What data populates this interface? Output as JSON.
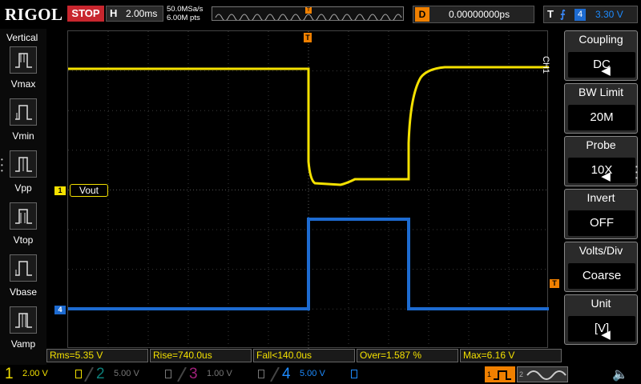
{
  "brand": "RIGOL",
  "run_status": "STOP",
  "horizontal": {
    "label": "H",
    "scale": "2.00ms"
  },
  "acquisition": {
    "sample_rate": "50.0MSa/s",
    "memory_depth": "6.00M pts"
  },
  "delay": {
    "label": "D",
    "value": "0.00000000ps"
  },
  "trigger": {
    "label": "T",
    "edge": "rising",
    "source": "4",
    "level": "3.30 V",
    "marker": "T"
  },
  "left_panel": {
    "title": "Vertical",
    "items": [
      "Vmax",
      "Vmin",
      "Vpp",
      "Vtop",
      "Vbase",
      "Vamp"
    ]
  },
  "channel_tab": "CH1",
  "menu": [
    {
      "title": "Coupling",
      "value": "DC"
    },
    {
      "title": "BW Limit",
      "value": "20M"
    },
    {
      "title": "Probe",
      "value": "10X"
    },
    {
      "title": "Invert",
      "value": "OFF"
    },
    {
      "title": "Volts/Div",
      "value": "Coarse"
    },
    {
      "title": "Unit",
      "value": "[V]"
    }
  ],
  "trace_label": "Vout",
  "markers": {
    "ch1": "1",
    "ch4": "4"
  },
  "measurements": [
    "Rms=5.35 V",
    "Rise=740.0us",
    "Fall<140.0us",
    "Over=1.587 %",
    "Max=6.16 V"
  ],
  "channels": [
    {
      "num": "1",
      "scale": "2.00 V",
      "color": "#f4e100"
    },
    {
      "num": "2",
      "scale": "5.00 V",
      "color": "#0d7f7a"
    },
    {
      "num": "3",
      "scale": "1.00 V",
      "color": "#a0207a"
    },
    {
      "num": "4",
      "scale": "5.00 V",
      "color": "#1d8bff"
    }
  ],
  "sources": {
    "one": "1",
    "two": "2"
  },
  "colors": {
    "ch1": "#f4e100",
    "ch4": "#1d6bd1",
    "trigger": "#f08000",
    "stop": "#c8262e"
  }
}
